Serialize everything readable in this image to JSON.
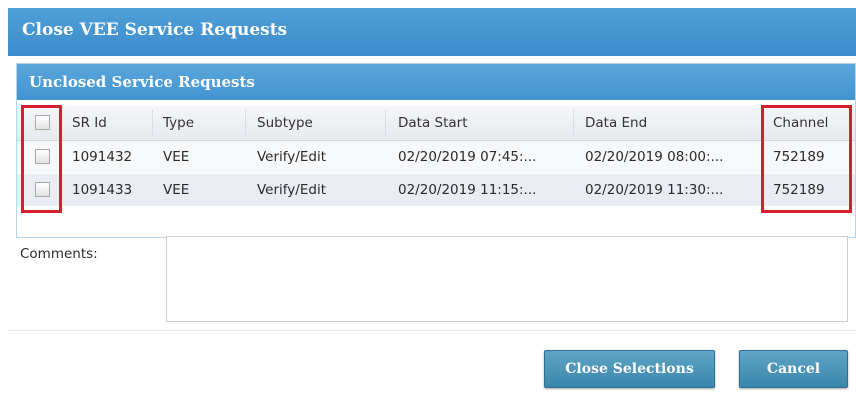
{
  "dialog": {
    "title": "Close VEE Service Requests"
  },
  "panel": {
    "title": "Unclosed Service Requests"
  },
  "table": {
    "columns": [
      "SR Id",
      "Type",
      "Subtype",
      "Data Start",
      "Data End",
      "Channel"
    ],
    "rows": [
      {
        "checked": false,
        "sr_id": "1091432",
        "type": "VEE",
        "subtype": "Verify/Edit",
        "data_start": "02/20/2019 07:45:...",
        "data_end": "02/20/2019 08:00:...",
        "channel": "752189"
      },
      {
        "checked": false,
        "sr_id": "1091433",
        "type": "VEE",
        "subtype": "Verify/Edit",
        "data_start": "02/20/2019 11:15:...",
        "data_end": "02/20/2019 11:30:...",
        "channel": "752189"
      }
    ],
    "highlight_color": "#d61f2c"
  },
  "comments": {
    "label": "Comments:",
    "value": ""
  },
  "buttons": {
    "close_selections": "Close Selections",
    "cancel": "Cancel"
  },
  "colors": {
    "title_bar": "#4a98d6",
    "button": "#4a93b8"
  }
}
